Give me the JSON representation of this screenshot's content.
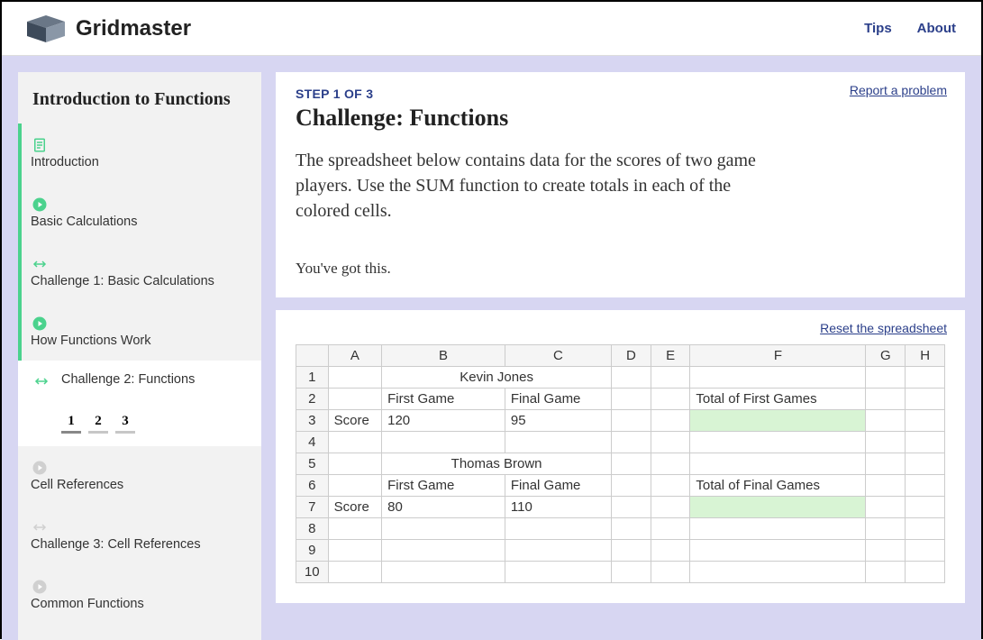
{
  "header": {
    "brand": "Gridmaster",
    "nav": {
      "tips": "Tips",
      "about": "About"
    }
  },
  "sidebar": {
    "title": "Introduction to Functions",
    "items": [
      {
        "label": "Introduction",
        "icon": "doc",
        "status": "done"
      },
      {
        "label": "Basic Calculations",
        "icon": "play",
        "status": "done"
      },
      {
        "label": "Challenge 1: Basic Calculations",
        "icon": "arrows",
        "status": "done"
      },
      {
        "label": "How Functions Work",
        "icon": "play",
        "status": "done"
      },
      {
        "label": "Challenge 2: Functions",
        "icon": "arrows",
        "status": "current",
        "steps": [
          "1",
          "2",
          "3"
        ],
        "active_step": 0
      },
      {
        "label": "Cell References",
        "icon": "play",
        "status": "idle"
      },
      {
        "label": "Challenge 3: Cell References",
        "icon": "arrows",
        "status": "idle"
      },
      {
        "label": "Common Functions",
        "icon": "play",
        "status": "idle"
      }
    ]
  },
  "challenge": {
    "step_label": "STEP 1 OF 3",
    "title": "Challenge: Functions",
    "instructions": "The spreadsheet below contains data for the scores of two game players. Use the SUM function to create totals in each of the colored cells.",
    "encouragement": "You've got this.",
    "report_link": "Report a problem",
    "reset_link": "Reset the spreadsheet"
  },
  "spreadsheet": {
    "columns": [
      "A",
      "B",
      "C",
      "D",
      "E",
      "F",
      "G",
      "H"
    ],
    "cells": {
      "B1": "Kevin Jones",
      "B2": "First Game",
      "C2": "Final Game",
      "F2": "Total of First Games",
      "A3": "Score",
      "B3": "120",
      "C3": "95",
      "B5": "Thomas Brown",
      "B6": "First Game",
      "C6": "Final Game",
      "F6": "Total of Final Games",
      "A7": "Score",
      "B7": "80",
      "C7": "110"
    },
    "highlight": [
      "F3",
      "F7"
    ],
    "rows": 10
  }
}
